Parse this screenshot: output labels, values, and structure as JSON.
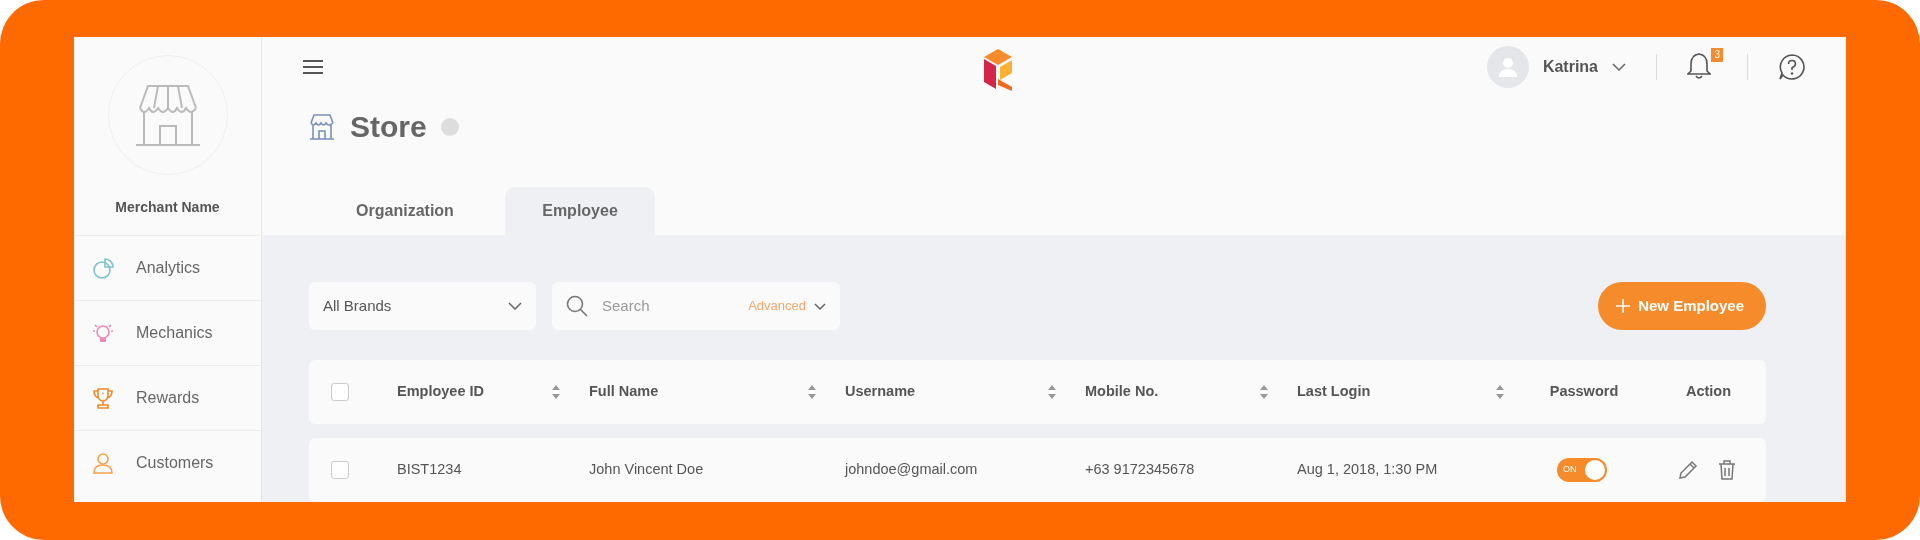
{
  "header": {
    "user": {
      "name": "Katrina"
    },
    "notifications": {
      "count": "3"
    }
  },
  "sidebar": {
    "merchant_name": "Merchant Name",
    "items": [
      {
        "label": "Analytics"
      },
      {
        "label": "Mechanics"
      },
      {
        "label": "Rewards"
      },
      {
        "label": "Customers"
      }
    ]
  },
  "page": {
    "title": "Store",
    "tabs": [
      {
        "label": "Organization",
        "selected": false
      },
      {
        "label": "Employee",
        "selected": true
      }
    ]
  },
  "toolbar": {
    "brand_filter": {
      "value": "All Brands"
    },
    "search": {
      "placeholder": "Search",
      "advanced_label": "Advanced"
    },
    "new_button": {
      "label": "New Employee"
    }
  },
  "table": {
    "select_all": {
      "checked": false
    },
    "columns": [
      {
        "label": "Employee ID",
        "sortable": true
      },
      {
        "label": "Full Name",
        "sortable": true
      },
      {
        "label": "Username",
        "sortable": true
      },
      {
        "label": "Mobile No.",
        "sortable": true
      },
      {
        "label": "Last Login",
        "sortable": true
      },
      {
        "label": "Password",
        "sortable": false
      },
      {
        "label": "Action",
        "sortable": false
      }
    ],
    "rows": [
      {
        "checked": false,
        "cells": [
          "BIST1234",
          "John Vincent Doe",
          "johndoe@gmail.com",
          "+63 9172345678",
          "Aug 1, 2018, 1:30 PM"
        ],
        "password": {
          "on": true,
          "label": "ON"
        }
      }
    ]
  }
}
